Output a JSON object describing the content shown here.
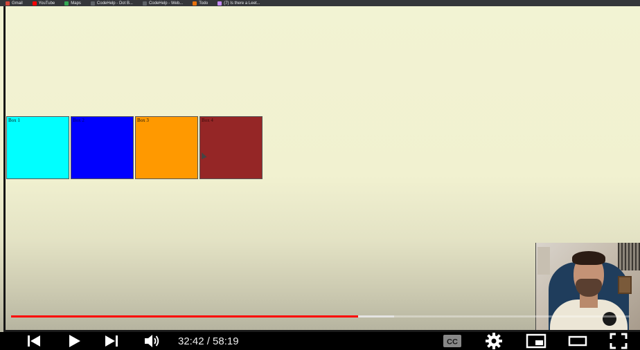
{
  "bookmarks": [
    {
      "label": "Gmail",
      "icon": "gmail-icon",
      "color": "#d44638"
    },
    {
      "label": "YouTube",
      "icon": "youtube-icon",
      "color": "#ff0000"
    },
    {
      "label": "Maps",
      "icon": "maps-icon",
      "color": "#34a853"
    },
    {
      "label": "CodeHelp - Dot B...",
      "icon": "codehelp-icon",
      "color": "#5f6368"
    },
    {
      "label": "CodeHelp - Web...",
      "icon": "codehelp-icon",
      "color": "#5f6368"
    },
    {
      "label": "Todo",
      "icon": "todo-icon",
      "color": "#e8710a"
    },
    {
      "label": "(7) Is there a Leet...",
      "icon": "page-icon",
      "color": "#c58af9"
    }
  ],
  "boxes": [
    {
      "label": "Box 1",
      "color": "#00ffff"
    },
    {
      "label": "Box 2",
      "color": "#0000ff"
    },
    {
      "label": "Box 3",
      "color": "#ff9900"
    },
    {
      "label": "Box 4",
      "color": "#952626"
    }
  ],
  "player": {
    "current_time": "32:42",
    "duration": "58:19",
    "time_display": "32:42 / 58:19",
    "played_fraction": 0.5608,
    "buffered_fraction": 0.619,
    "accent_color": "#ff0000"
  },
  "controls": [
    "previous-icon",
    "play-icon",
    "next-icon",
    "volume-icon",
    "captions-icon",
    "settings-icon",
    "miniplayer-icon",
    "theater-icon",
    "fullscreen-icon"
  ]
}
